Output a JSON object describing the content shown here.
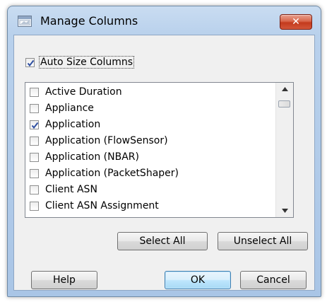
{
  "window": {
    "title": "Manage Columns",
    "close_symbol": "✕"
  },
  "auto_size": {
    "label": "Auto Size Columns",
    "checked": true
  },
  "columns": [
    {
      "label": "Active Duration",
      "checked": false
    },
    {
      "label": "Appliance",
      "checked": false
    },
    {
      "label": "Application",
      "checked": true
    },
    {
      "label": "Application (FlowSensor)",
      "checked": false
    },
    {
      "label": "Application (NBAR)",
      "checked": false
    },
    {
      "label": "Application (PacketShaper)",
      "checked": false
    },
    {
      "label": "Client ASN",
      "checked": false
    },
    {
      "label": "Client ASN Assignment",
      "checked": false
    }
  ],
  "buttons": {
    "select_all": "Select All",
    "unselect_all": "Unselect All",
    "help": "Help",
    "ok": "OK",
    "cancel": "Cancel"
  },
  "icons": {
    "window": "dialog-window-icon",
    "close": "close-icon",
    "check": "checkmark-icon",
    "scroll_up": "chevron-up-icon",
    "scroll_down": "chevron-down-icon"
  },
  "colors": {
    "close_button": "#c43b1d",
    "check_mark": "#2f4fa0",
    "default_button": "#3c7fb1"
  }
}
